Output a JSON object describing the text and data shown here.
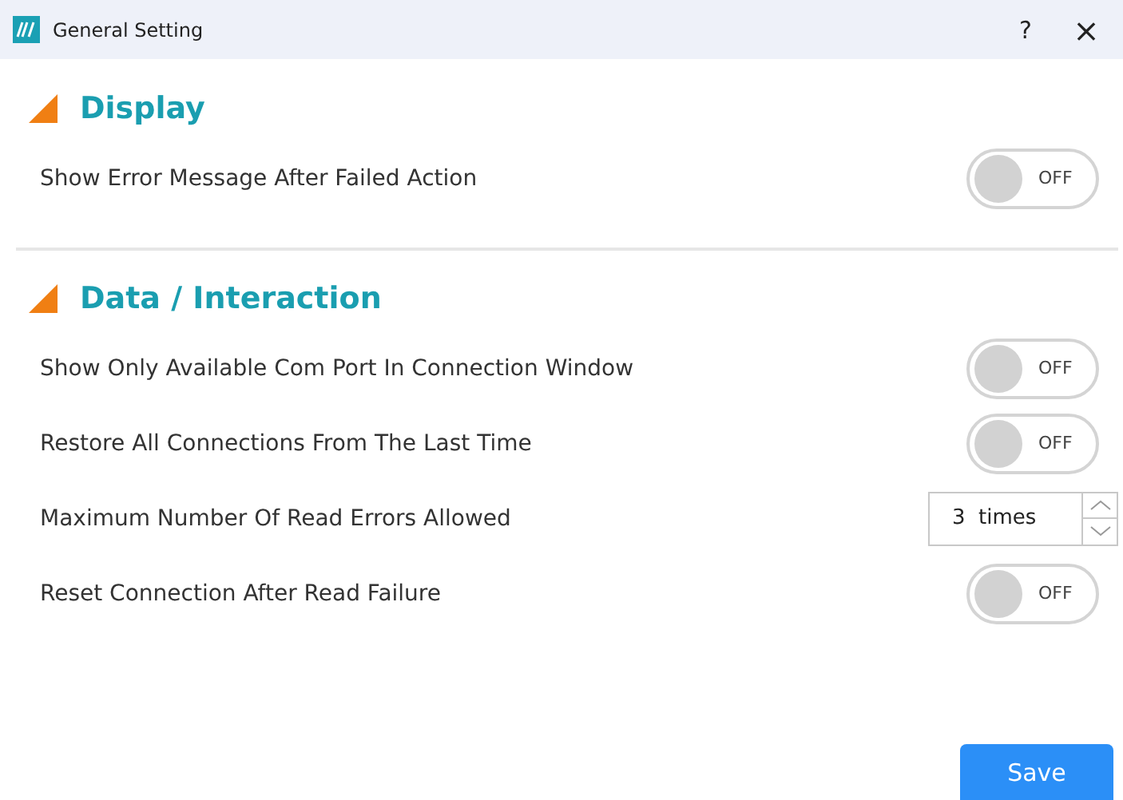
{
  "window": {
    "title": "General Setting",
    "help": "?",
    "close": "×"
  },
  "sections": [
    {
      "title": "Display",
      "rows": [
        {
          "kind": "toggle",
          "label": "Show Error Message After Failed Action",
          "on": false,
          "state_label": "OFF"
        }
      ]
    },
    {
      "title": "Data / Interaction",
      "rows": [
        {
          "kind": "toggle",
          "label": "Show Only Available Com Port In Connection Window",
          "on": false,
          "state_label": "OFF"
        },
        {
          "kind": "toggle",
          "label": "Restore All Connections From The Last Time",
          "on": false,
          "state_label": "OFF"
        },
        {
          "kind": "spinner",
          "label": "Maximum Number Of Read Errors Allowed",
          "value": "3  times"
        },
        {
          "kind": "toggle",
          "label": "Reset Connection After Read Failure",
          "on": false,
          "state_label": "OFF"
        }
      ]
    }
  ],
  "save_button": "Save"
}
